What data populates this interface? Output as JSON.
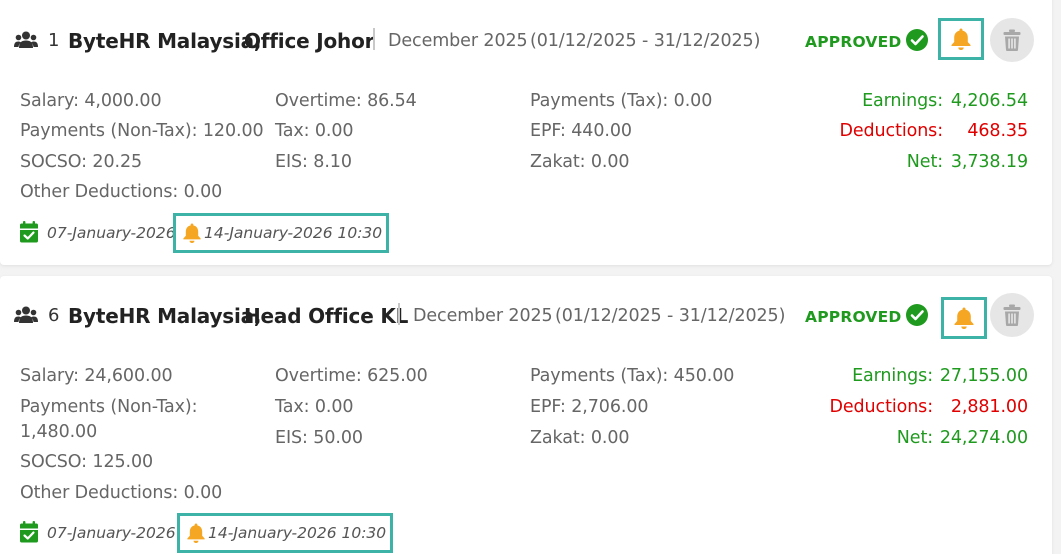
{
  "colors": {
    "accent": "#3db3a7",
    "approved": "#1f9a1f",
    "deductions": "#e00000",
    "bell": "#f5a623"
  },
  "icons": {
    "group": "people-icon",
    "approved": "check-circle-icon",
    "notify": "bell-icon",
    "delete": "trash-icon",
    "date": "calendar-check-icon"
  },
  "cards": [
    {
      "count": "1",
      "company": "ByteHR Malaysia,",
      "office": "Office Johor",
      "month": "December 2025",
      "range": "(01/12/2025 - 31/12/2025)",
      "status": "APPROVED",
      "fields": {
        "salary": "Salary: 4,000.00",
        "payments_nontax": "Payments (Non-Tax): 120.00",
        "socso": "SOCSO: 20.25",
        "other_deductions": "Other Deductions: 0.00",
        "overtime": "Overtime: 86.54",
        "tax": "Tax: 0.00",
        "eis": "EIS: 8.10",
        "payments_tax": "Payments (Tax): 0.00",
        "epf": "EPF: 440.00",
        "zakat": "Zakat: 0.00"
      },
      "summary": {
        "earnings_label": "Earnings:",
        "earnings": "4,206.54",
        "deductions_label": "Deductions:",
        "deductions": "468.35",
        "net_label": "Net:",
        "net": "3,738.19"
      },
      "date": "07-January-2026",
      "reminder": "14-January-2026 10:30"
    },
    {
      "count": "6",
      "company": "ByteHR Malaysia,",
      "office": "Head Office KL",
      "month": "December 2025",
      "range": "(01/12/2025 - 31/12/2025)",
      "status": "APPROVED",
      "fields": {
        "salary": "Salary: 24,600.00",
        "payments_nontax_1": "Payments (Non-Tax):",
        "payments_nontax_2": "1,480.00",
        "socso": "SOCSO: 125.00",
        "other_deductions": "Other Deductions: 0.00",
        "overtime": "Overtime: 625.00",
        "tax": "Tax: 0.00",
        "eis": "EIS: 50.00",
        "payments_tax": "Payments (Tax): 450.00",
        "epf": "EPF: 2,706.00",
        "zakat": "Zakat: 0.00"
      },
      "summary": {
        "earnings_label": "Earnings:",
        "earnings": "27,155.00",
        "deductions_label": "Deductions:",
        "deductions": "2,881.00",
        "net_label": "Net:",
        "net": "24,274.00"
      },
      "date": "07-January-2026",
      "reminder": "14-January-2026 10:30"
    }
  ]
}
